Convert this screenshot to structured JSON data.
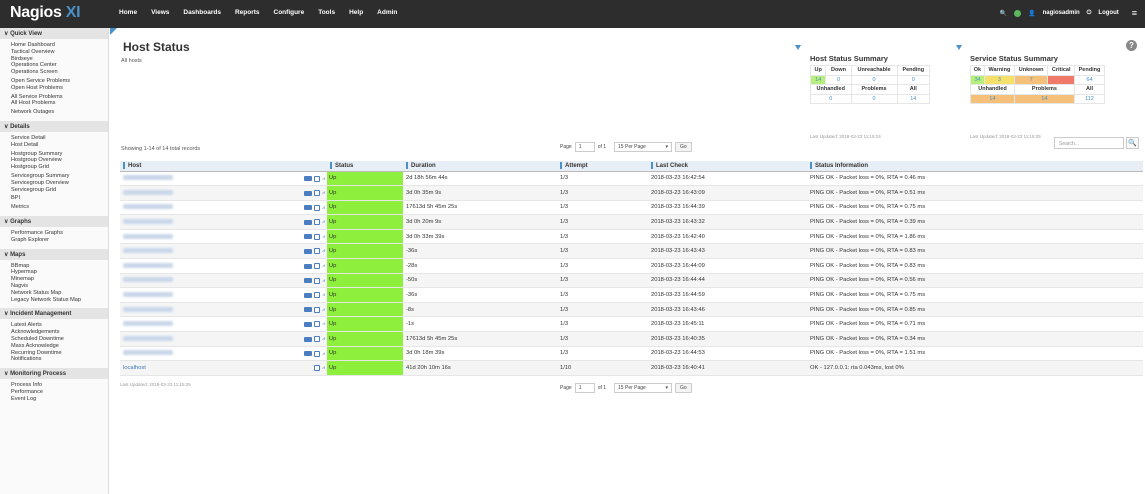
{
  "app": {
    "logo_main": "Nagios",
    "logo_suffix": "XI"
  },
  "nav": [
    "Home",
    "Views",
    "Dashboards",
    "Reports",
    "Configure",
    "Tools",
    "Help",
    "Admin"
  ],
  "user": {
    "search_glyph": "🔍",
    "name": "nagiosadmin",
    "logout": "Logout",
    "menu_glyph": "≡"
  },
  "sidebar": [
    {
      "heading": "Quick View",
      "items": [
        "Home Dashboard",
        "Tactical Overview",
        "Birdseye",
        "Operations Center",
        "Operations Screen",
        "",
        "Open Service Problems",
        "Open Host Problems",
        "",
        "All Service Problems",
        "All Host Problems",
        "",
        "Network Outages"
      ]
    },
    {
      "heading": "Details",
      "items": [
        "Service Detail",
        "Host Detail",
        "",
        "Hostgroup Summary",
        "Hostgroup Overview",
        "Hostgroup Grid",
        "",
        "Servicegroup Summary",
        "Servicegroup Overview",
        "Servicegroup Grid",
        "",
        "BPI",
        "",
        "Metrics"
      ]
    },
    {
      "heading": "Graphs",
      "items": [
        "Performance Graphs",
        "Graph Explorer"
      ]
    },
    {
      "heading": "Maps",
      "items": [
        "BBmap",
        "Hypermap",
        "Minemap",
        "Nagvis",
        "Network Status Map",
        "Legacy Network Status Map"
      ]
    },
    {
      "heading": "Incident Management",
      "items": [
        "Latest Alerts",
        "Acknowledgements",
        "Scheduled Downtime",
        "Mass Acknowledge",
        "Recurring Downtime",
        "Notifications"
      ]
    },
    {
      "heading": "Monitoring Process",
      "items": [
        "Process Info",
        "Performance",
        "Event Log"
      ]
    }
  ],
  "page": {
    "title": "Host Status",
    "subtitle": "All hosts",
    "help_glyph": "?"
  },
  "host_summary": {
    "title": "Host Status Summary",
    "headers": [
      "Up",
      "Down",
      "Unreachable",
      "Pending"
    ],
    "values": [
      "14",
      "0",
      "0",
      "0"
    ],
    "headers2": [
      "Unhandled",
      "Problems",
      "All"
    ],
    "values2": [
      "0",
      "0",
      "14"
    ],
    "updated": "Last Updated: 2018-03-23 11:15:24"
  },
  "service_summary": {
    "title": "Service Status Summary",
    "headers": [
      "Ok",
      "Warning",
      "Unknown",
      "Critical",
      "Pending"
    ],
    "values": [
      "34",
      "3",
      "7",
      "",
      "64"
    ],
    "headers2": [
      "Unhandled",
      "Problems",
      "All"
    ],
    "values2": [
      "14",
      "14",
      "112"
    ],
    "updated": "Last Updated: 2018-03-23 11:15:25"
  },
  "colors": {
    "up": "#8ef03d",
    "ok": "#b6f07a",
    "warning": "#f5e06a",
    "unknown": "#f5c07a",
    "critical": "#f07a6a",
    "problems": "#f5c07a",
    "accent": "#4a90c9"
  },
  "controls": {
    "showing": "Showing 1-14 of 14 total records",
    "page_label": "Page",
    "page_value": "1",
    "of_label": "of 1",
    "per_page": "15 Per Page",
    "go": "Go",
    "search_placeholder": "Search...",
    "search_glyph": "🔍"
  },
  "table": {
    "headers": [
      "Host",
      "Status",
      "Duration",
      "Attempt",
      "Last Check",
      "Status Information"
    ],
    "rows": [
      {
        "host": "",
        "status": "Up",
        "duration": "2d 18h 56m 44s",
        "attempt": "1/3",
        "last_check": "2018-03-23 16:42:54",
        "info": "PING OK - Packet loss = 0%, RTA = 0.46 ms"
      },
      {
        "host": "",
        "status": "Up",
        "duration": "3d 0h 35m 9s",
        "attempt": "1/3",
        "last_check": "2018-03-23 16:43:09",
        "info": "PING OK - Packet loss = 0%, RTA = 0.51 ms"
      },
      {
        "host": "",
        "status": "Up",
        "duration": "17613d 5h 45m 25s",
        "attempt": "1/3",
        "last_check": "2018-03-23 16:44:39",
        "info": "PING OK - Packet loss = 0%, RTA = 0.75 ms"
      },
      {
        "host": "",
        "status": "Up",
        "duration": "3d 0h 20m 9s",
        "attempt": "1/3",
        "last_check": "2018-03-23 16:43:32",
        "info": "PING OK - Packet loss = 0%, RTA = 0.39 ms"
      },
      {
        "host": "",
        "status": "Up",
        "duration": "3d 0h 33m 39s",
        "attempt": "1/3",
        "last_check": "2018-03-23 16:42:40",
        "info": "PING OK - Packet loss = 0%, RTA = 1.86 ms"
      },
      {
        "host": "",
        "status": "Up",
        "duration": "-36s",
        "attempt": "1/3",
        "last_check": "2018-03-23 16:43:43",
        "info": "PING OK - Packet loss = 0%, RTA = 0.83 ms"
      },
      {
        "host": "",
        "status": "Up",
        "duration": "-28s",
        "attempt": "1/3",
        "last_check": "2018-03-23 16:44:09",
        "info": "PING OK - Packet loss = 0%, RTA = 0.83 ms"
      },
      {
        "host": "",
        "status": "Up",
        "duration": "-50s",
        "attempt": "1/3",
        "last_check": "2018-03-23 16:44:44",
        "info": "PING OK - Packet loss = 0%, RTA = 0.56 ms"
      },
      {
        "host": "",
        "status": "Up",
        "duration": "-36s",
        "attempt": "1/3",
        "last_check": "2018-03-23 16:44:59",
        "info": "PING OK - Packet loss = 0%, RTA = 0.75 ms"
      },
      {
        "host": "",
        "status": "Up",
        "duration": "-8s",
        "attempt": "1/3",
        "last_check": "2018-03-23 16:43:46",
        "info": "PING OK - Packet loss = 0%, RTA = 0.85 ms"
      },
      {
        "host": "",
        "status": "Up",
        "duration": "-1s",
        "attempt": "1/3",
        "last_check": "2018-03-23 16:45:11",
        "info": "PING OK - Packet loss = 0%, RTA = 0.71 ms"
      },
      {
        "host": "",
        "status": "Up",
        "duration": "17613d 5h 45m 25s",
        "attempt": "1/3",
        "last_check": "2018-03-23 16:40:35",
        "info": "PING OK - Packet loss = 0%, RTA = 0.34 ms"
      },
      {
        "host": "",
        "status": "Up",
        "duration": "3d 0h 18m 39s",
        "attempt": "1/3",
        "last_check": "2018-03-23 16:44:53",
        "info": "PING OK - Packet loss = 0%, RTA = 1.51 ms"
      },
      {
        "host": "localhost",
        "status": "Up",
        "duration": "41d 20h 10m 16s",
        "attempt": "1/10",
        "last_check": "2018-03-23 16:40:41",
        "info": "OK - 127.0.0.1: rta 0.043ms, lost 0%"
      }
    ]
  },
  "footer": {
    "updated": "Last Updated: 2018-03-23 11:15:25"
  }
}
